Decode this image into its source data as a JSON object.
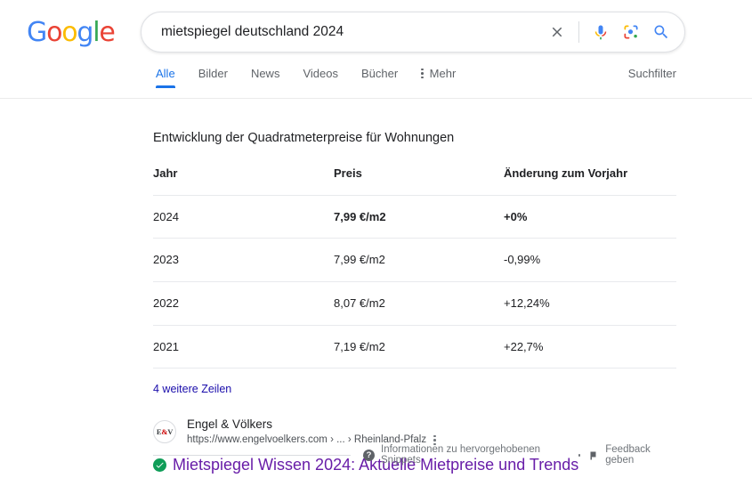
{
  "brand": {
    "logo_letters": [
      "G",
      "o",
      "o",
      "g",
      "l",
      "e"
    ],
    "colors": {
      "blue": "#4285F4",
      "red": "#EA4335",
      "yellow": "#FBBC05",
      "green": "#34A853",
      "link_blue": "#1a0dab",
      "link_visited": "#681da8",
      "tab_active": "#1a73e8",
      "verified_green": "#0f9d58"
    }
  },
  "search": {
    "query": "mietspiegel deutschland 2024",
    "placeholder": "Suche",
    "clear_label": "Löschen",
    "voice_label": "Sprachsuche",
    "lens_label": "Suche mit Google Lens",
    "submit_label": "Google Suche"
  },
  "tabs": {
    "items": [
      {
        "label": "Alle",
        "active": true
      },
      {
        "label": "Bilder",
        "active": false
      },
      {
        "label": "News",
        "active": false
      },
      {
        "label": "Videos",
        "active": false
      },
      {
        "label": "Bücher",
        "active": false
      }
    ],
    "more_label": "Mehr",
    "filters_label": "Suchfilter"
  },
  "snippet": {
    "title": "Entwicklung der Quadratmeterpreise für Wohnungen",
    "table": {
      "headers": [
        "Jahr",
        "Preis",
        "Änderung zum Vorjahr"
      ],
      "rows": [
        {
          "jahr": "2024",
          "preis": "7,99 €/m2",
          "aenderung": "+0%",
          "highlight": true
        },
        {
          "jahr": "2023",
          "preis": "7,99 €/m2",
          "aenderung": "-0,99%",
          "highlight": false
        },
        {
          "jahr": "2022",
          "preis": "8,07 €/m2",
          "aenderung": "+12,24%",
          "highlight": false
        },
        {
          "jahr": "2021",
          "preis": "7,19 €/m2",
          "aenderung": "+22,7%",
          "highlight": false
        }
      ]
    },
    "more_rows_label": "4 weitere Zeilen"
  },
  "result": {
    "favicon_text": "E&V",
    "favicon_left": "E",
    "favicon_amp": "&",
    "favicon_right": "V",
    "site_name": "Engel & Völkers",
    "url": "https://www.engelvoelkers.com › ... › Rheinland-Pfalz",
    "title": "Mietspiegel Wissen 2024: Aktuelle Mietpreise und Trends"
  },
  "footer": {
    "info_label": "Informationen zu hervorgehobenen Snippets",
    "feedback_label": "Feedback geben"
  },
  "chart_data": {
    "type": "table",
    "title": "Entwicklung der Quadratmeterpreise für Wohnungen",
    "columns": [
      "Jahr",
      "Preis",
      "Änderung zum Vorjahr"
    ],
    "categories": [
      "2024",
      "2023",
      "2022",
      "2021"
    ],
    "series": [
      {
        "name": "Preis (€/m2)",
        "values": [
          7.99,
          7.99,
          8.07,
          7.19
        ]
      },
      {
        "name": "Änderung zum Vorjahr (%)",
        "values": [
          0,
          -0.99,
          12.24,
          22.7
        ]
      }
    ],
    "units": {
      "Preis": "€/m2",
      "Änderung zum Vorjahr": "%"
    },
    "note": "4 weitere Zeilen"
  }
}
